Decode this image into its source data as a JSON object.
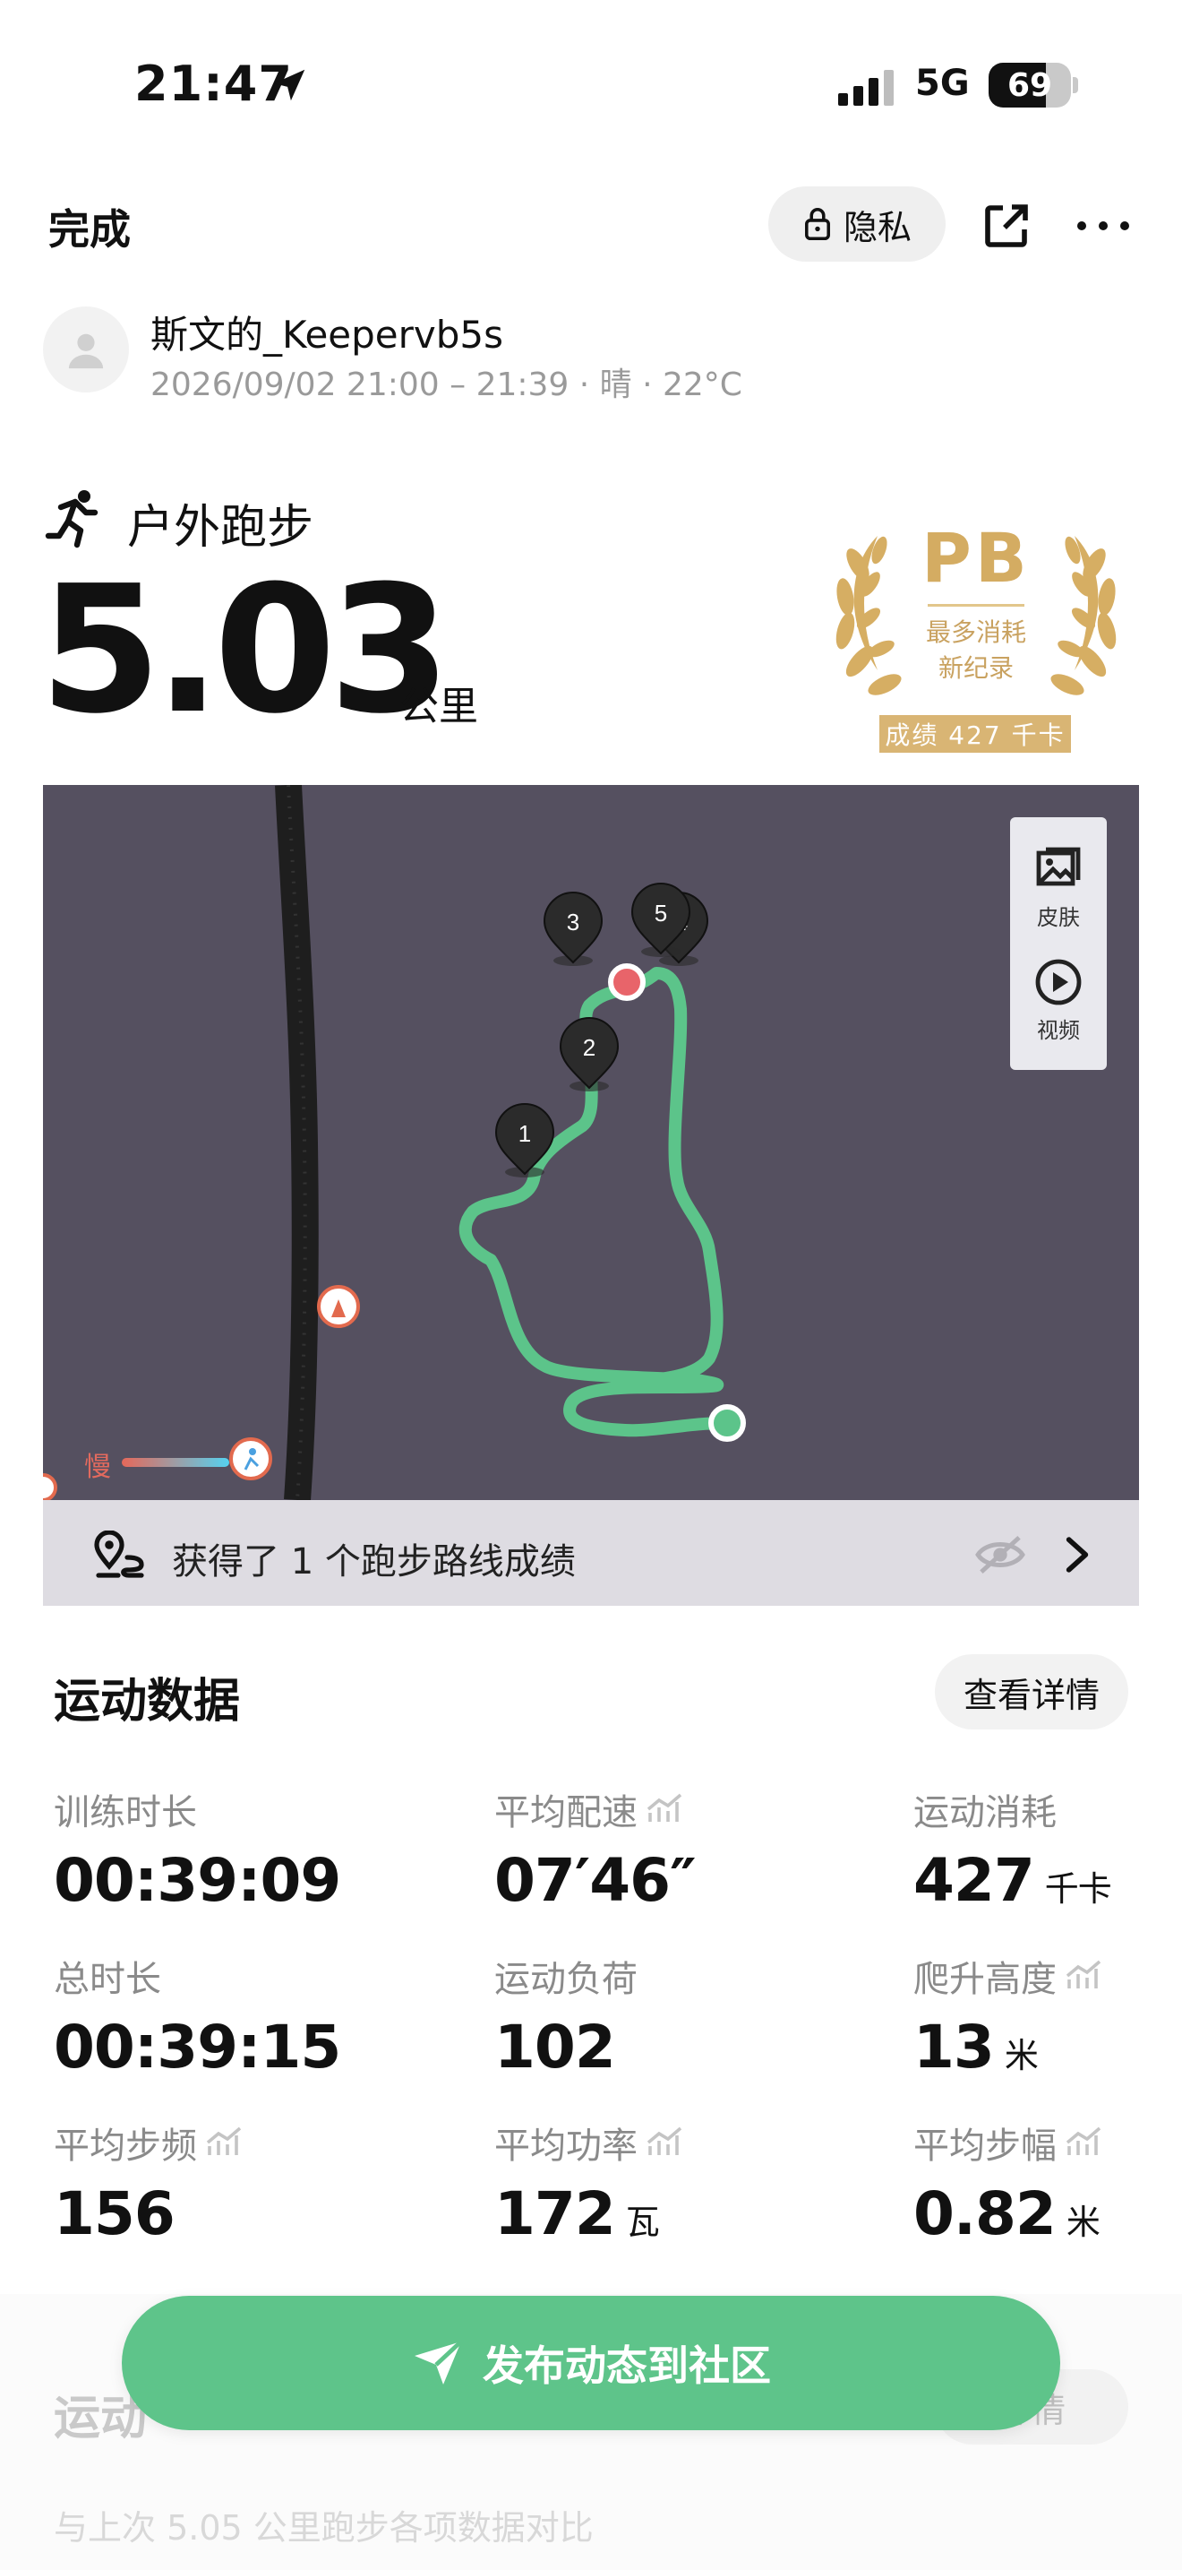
{
  "status_bar": {
    "time": "21:47",
    "network": "5G",
    "battery": "69"
  },
  "nav": {
    "done_label": "完成",
    "privacy_label": "隐私"
  },
  "user": {
    "name": "斯文的_Keepervb5s",
    "meta": "2026/09/02 21:00 – 21:39 · 晴 · 22°C"
  },
  "sport": {
    "type": "户外跑步",
    "distance": "5.03",
    "distance_unit": "公里"
  },
  "pb": {
    "title": "PB",
    "line1": "最多消耗",
    "line2": "新纪录",
    "score": "成绩 427 千卡"
  },
  "map": {
    "markers": [
      "1",
      "2",
      "3",
      "4",
      "5"
    ],
    "tools": {
      "skin": "皮肤",
      "video": "视频"
    },
    "speed_legend": "慢"
  },
  "achievement": {
    "text": "获得了 1 个跑步路线成绩"
  },
  "stats_section": {
    "title": "运动数据",
    "detail_label": "查看详情",
    "metrics": [
      {
        "label": "训练时长",
        "value": "00:39:09",
        "unit": ""
      },
      {
        "label": "平均配速",
        "value": "07′46″",
        "unit": ""
      },
      {
        "label": "运动消耗",
        "value": "427",
        "unit": "千卡"
      },
      {
        "label": "总时长",
        "value": "00:39:15",
        "unit": ""
      },
      {
        "label": "运动负荷",
        "value": "102",
        "unit": ""
      },
      {
        "label": "爬升高度",
        "value": "13",
        "unit": "米"
      },
      {
        "label": "平均步频",
        "value": "156",
        "unit": ""
      },
      {
        "label": "平均功率",
        "value": "172",
        "unit": "瓦"
      },
      {
        "label": "平均步幅",
        "value": "0.82",
        "unit": "米"
      }
    ]
  },
  "section2": {
    "title": "运动",
    "detail_label": "详情",
    "compare_text": "与上次 5.05 公里跑步各项数据对比"
  },
  "publish": {
    "label": "发布动态到社区"
  },
  "colors": {
    "accent_green": "#5ec48a",
    "route_green": "#5cc48a",
    "start_red": "#e8646a",
    "map_bg": "#555060",
    "pb_gold": "#d4ac62"
  }
}
